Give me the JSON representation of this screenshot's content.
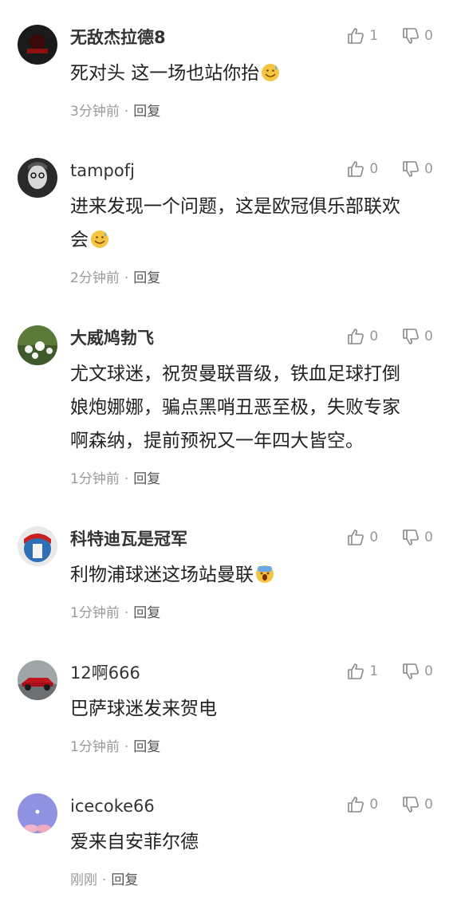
{
  "comments": [
    {
      "username": "无敌杰拉德8",
      "text": "死对头 这一场也站你抬",
      "emoji": "sweat-smile-emoji",
      "time": "3分钟前",
      "reply": "回复",
      "likes": "1",
      "dislikes": "0"
    },
    {
      "username": "tampofj",
      "text": "进来发现一个问题，这是欧冠俱乐部联欢\n会",
      "emoji": "sweat-smile-emoji",
      "time": "2分钟前",
      "reply": "回复",
      "likes": "0",
      "dislikes": "0"
    },
    {
      "username": "大威鸠勃飞",
      "text": "尤文球迷，祝贺曼联晋级，铁血足球打倒\n娘炮娜娜，骗点黑哨丑恶至极，失败专家\n啊森纳，提前预祝又一年四大皆空。",
      "emoji": "",
      "time": "1分钟前",
      "reply": "回复",
      "likes": "0",
      "dislikes": "0"
    },
    {
      "username": "科特迪瓦是冠军",
      "text": "利物浦球迷这场站曼联",
      "emoji": "scared-face-emoji",
      "time": "1分钟前",
      "reply": "回复",
      "likes": "0",
      "dislikes": "0"
    },
    {
      "username": "12啊666",
      "text": "巴萨球迷发来贺电",
      "emoji": "",
      "time": "1分钟前",
      "reply": "回复",
      "likes": "1",
      "dislikes": "0"
    },
    {
      "username": "icecoke66",
      "text": "爱来自安菲尔德",
      "emoji": "",
      "time": "刚刚",
      "reply": "回复",
      "likes": "0",
      "dislikes": "0"
    }
  ],
  "icons": {
    "like": "thumbs-up-icon",
    "dislike": "thumbs-down-icon"
  },
  "colors": {
    "text": "#222222",
    "meta": "#999999",
    "icon": "#888888"
  }
}
